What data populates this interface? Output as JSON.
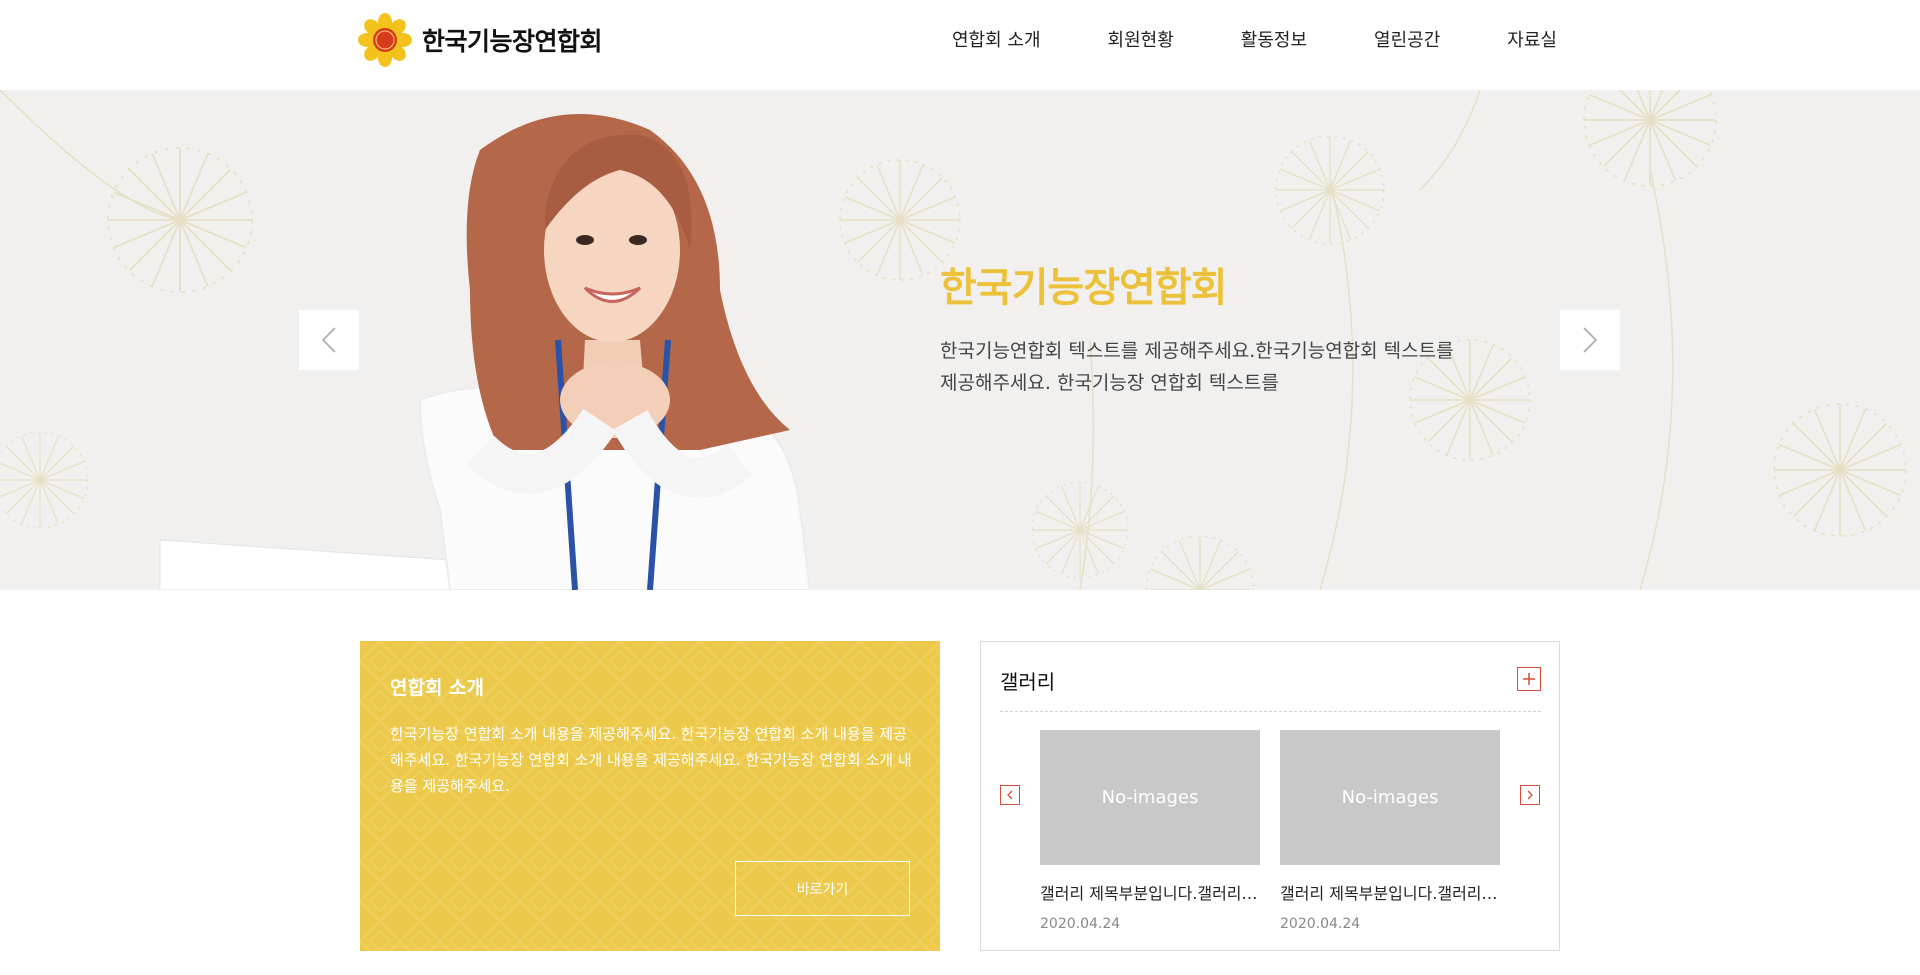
{
  "header": {
    "logo_text": "한국기능장연합회",
    "nav": [
      "연합회 소개",
      "회원현황",
      "활동정보",
      "열린공간",
      "자료실"
    ]
  },
  "hero": {
    "title": "한국기능장연합회",
    "description": "한국기능연합회 텍스트를 제공해주세요.한국기능연합회 텍스트를 제공해주세요. 한국기능장 연합회 텍스트를"
  },
  "intro": {
    "title": "연합회 소개",
    "description": "한국기능장 연합회 소개 내용을 제공해주세요. 한국기능장 연합회 소개 내용을 제공해주세요. 한국기능장 연합회 소개 내용을 제공해주세요. 한국기능장 연합회 소개 내용을 제공해주세요.",
    "button_label": "바로가기"
  },
  "gallery": {
    "title": "갤러리",
    "items": [
      {
        "thumb_text": "No-images",
        "caption": "갤러리 제목부분입니다.갤러리 제목부분입니다.",
        "date": "2020.04.24"
      },
      {
        "thumb_text": "No-images",
        "caption": "갤러리 제목부분입니다.갤러리 제목부분입니다.",
        "date": "2020.04.24"
      }
    ]
  },
  "colors": {
    "accent_yellow": "#ecc94a",
    "hero_title": "#ecc13c",
    "gallery_accent": "#d84d3d"
  }
}
